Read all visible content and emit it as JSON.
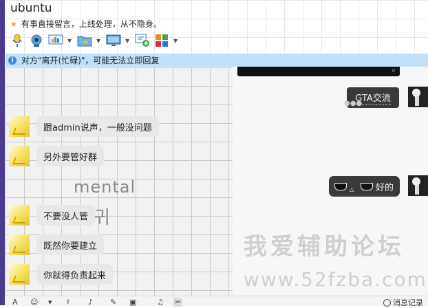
{
  "window": {
    "title": "ubuntu",
    "notice": "有事直接留言，上线处理，从不隐身。"
  },
  "status_bar": {
    "text": "对方\"离开(忙碌)\"，可能无法立即回复"
  },
  "toolbar": {
    "icons": [
      "microphone-icon",
      "video-icon",
      "screen-share-icon",
      "file-transfer-icon",
      "remote-desktop-icon",
      "message-add-icon",
      "apps-grid-icon"
    ]
  },
  "messages_left": [
    {
      "text": "跟admin说声，一般没问题"
    },
    {
      "text": "另外要管好群"
    },
    {
      "text": "不要没人管"
    },
    {
      "text": "既然你要建立"
    },
    {
      "text": "你就得负责起来"
    }
  ],
  "messages_right": [
    {
      "text": "GTA交流"
    },
    {
      "text": "好的"
    }
  ],
  "background_text": {
    "word": "mental",
    "hangul": "귀"
  },
  "watermark": {
    "line1": "我爱辅助论坛",
    "line2": "www.52fzba.com"
  },
  "bottom_toolbar": {
    "history_label": "消息记录"
  },
  "colors": {
    "status_bar_bg": "#bfe0f8",
    "accent_left_edge": "#4b3a8e",
    "bubble_left": "#e8e8e8",
    "bubble_right": "#3a3a3a"
  }
}
